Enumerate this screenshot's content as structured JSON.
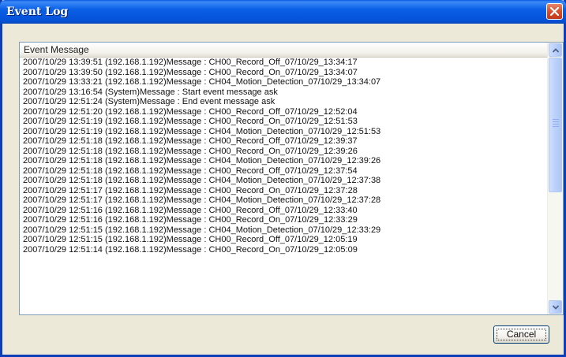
{
  "window": {
    "title": "Event Log",
    "titlebar_color": "#0a5fe6",
    "close_icon": "close-icon"
  },
  "list": {
    "column_header": "Event Message",
    "rows": [
      "2007/10/29 13:39:51 (192.168.1.192)Message : CH00_Record_Off_07/10/29_13:34:17",
      "2007/10/29 13:39:50 (192.168.1.192)Message : CH00_Record_On_07/10/29_13:34:07",
      "2007/10/29 13:33:21 (192.168.1.192)Message : CH04_Motion_Detection_07/10/29_13:34:07",
      "2007/10/29 13:16:54 (System)Message : Start event message ask",
      "2007/10/29 12:51:24 (System)Message : End event message ask",
      "2007/10/29 12:51:20 (192.168.1.192)Message : CH00_Record_Off_07/10/29_12:52:04",
      "2007/10/29 12:51:19 (192.168.1.192)Message : CH00_Record_On_07/10/29_12:51:53",
      "2007/10/29 12:51:19 (192.168.1.192)Message : CH04_Motion_Detection_07/10/29_12:51:53",
      "2007/10/29 12:51:18 (192.168.1.192)Message : CH00_Record_Off_07/10/29_12:39:37",
      "2007/10/29 12:51:18 (192.168.1.192)Message : CH00_Record_On_07/10/29_12:39:26",
      "2007/10/29 12:51:18 (192.168.1.192)Message : CH04_Motion_Detection_07/10/29_12:39:26",
      "2007/10/29 12:51:18 (192.168.1.192)Message : CH00_Record_Off_07/10/29_12:37:54",
      "2007/10/29 12:51:18 (192.168.1.192)Message : CH04_Motion_Detection_07/10/29_12:37:38",
      "2007/10/29 12:51:17 (192.168.1.192)Message : CH00_Record_On_07/10/29_12:37:28",
      "2007/10/29 12:51:17 (192.168.1.192)Message : CH04_Motion_Detection_07/10/29_12:37:28",
      "2007/10/29 12:51:16 (192.168.1.192)Message : CH00_Record_Off_07/10/29_12:33:40",
      "2007/10/29 12:51:16 (192.168.1.192)Message : CH00_Record_On_07/10/29_12:33:29",
      "2007/10/29 12:51:15 (192.168.1.192)Message : CH04_Motion_Detection_07/10/29_12:33:29",
      "2007/10/29 12:51:15 (192.168.1.192)Message : CH00_Record_Off_07/10/29_12:05:19",
      "2007/10/29 12:51:14 (192.168.1.192)Message : CH00_Record_On_07/10/29_12:05:09"
    ]
  },
  "scrollbar": {
    "up_icon": "chevron-up-icon",
    "down_icon": "chevron-down-icon"
  },
  "buttons": {
    "cancel_label": "Cancel"
  }
}
